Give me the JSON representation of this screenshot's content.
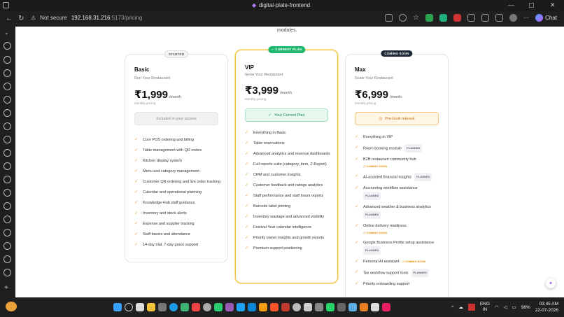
{
  "browser": {
    "tab_title": "digital-plate-frontend",
    "security_label": "Not secure",
    "url_host": "192.168.31.216",
    "url_path": ":5173/pricing",
    "chat_label": "Chat"
  },
  "page": {
    "top_note": "modules."
  },
  "plans": [
    {
      "badge": "STARTER",
      "name": "Basic",
      "tagline": "Run Your Restaurant",
      "price": "₹1,999",
      "period": "/month",
      "billing": "Monthly pricing",
      "cta": "Included in your access",
      "features": [
        {
          "text": "Core POS ordering and billing"
        },
        {
          "text": "Table management with QR codes"
        },
        {
          "text": "Kitchen display system"
        },
        {
          "text": "Menu and category management"
        },
        {
          "text": "Customer QR ordering and live order tracking"
        },
        {
          "text": "Calendar and operational planning"
        },
        {
          "text": "Knowledge Hub staff guidance"
        },
        {
          "text": "Inventory and stock alerts"
        },
        {
          "text": "Expense and supplier tracking"
        },
        {
          "text": "Staff basics and attendance"
        },
        {
          "text": "14-day trial, 7-day grace support"
        }
      ]
    },
    {
      "badge": "✓ CURRENT PLAN",
      "name": "VIP",
      "tagline": "Grow Your Restaurant",
      "price": "₹3,999",
      "period": "/month",
      "billing": "Monthly pricing",
      "cta": "Your Current Plan",
      "features": [
        {
          "text": "Everything in Basic"
        },
        {
          "text": "Table reservations"
        },
        {
          "text": "Advanced analytics and revenue dashboards"
        },
        {
          "text": "Full reports suite (category, item, Z-Report)"
        },
        {
          "text": "CRM and customer insights"
        },
        {
          "text": "Customer feedback and ratings analytics"
        },
        {
          "text": "Staff performance and staff hours reports"
        },
        {
          "text": "Barcode label printing"
        },
        {
          "text": "Inventory wastage and advanced visibility"
        },
        {
          "text": "Festival Year calendar intelligence"
        },
        {
          "text": "Priority owner insights and growth reports"
        },
        {
          "text": "Premium support positioning"
        }
      ]
    },
    {
      "badge": "COMING SOON",
      "name": "Max",
      "tagline": "Scale Your Restaurant",
      "price": "₹6,999",
      "period": "/month",
      "billing": "Monthly pricing",
      "cta": "Pre-book Interest",
      "features": [
        {
          "text": "Everything in VIP"
        },
        {
          "text": "Room booking module",
          "tag": "PLANNED"
        },
        {
          "text": "B2B restaurant community hub",
          "sub": "COMING SOON"
        },
        {
          "text": "AI-assisted financial insights",
          "tag": "PLANNED"
        },
        {
          "text": "Accounting workflow assistance",
          "subtag": "PLANNED"
        },
        {
          "text": "Advanced weather & business analytics",
          "subtag": "PLANNED"
        },
        {
          "text": "Online delivery readiness",
          "sub": "COMING SOON"
        },
        {
          "text": "Google Business Profile setup assistance",
          "subtag": "PLANNED"
        },
        {
          "text": "Personal AI assistant",
          "inline": "COMING SOON"
        },
        {
          "text": "Tax workflow support tools",
          "tag": "PLANNED"
        },
        {
          "text": "Priority onboarding support"
        }
      ]
    }
  ],
  "taskbar": {
    "lang_top": "ENG",
    "lang_bottom": "IN",
    "battery": "98%",
    "time": "03:45 AM",
    "date": "22-07-2026"
  },
  "colors": {
    "accent_gold": "#f0c040",
    "check": "#e6a23c",
    "current_green": "#1fb870",
    "coming_soon_orange": "#e08a00"
  }
}
